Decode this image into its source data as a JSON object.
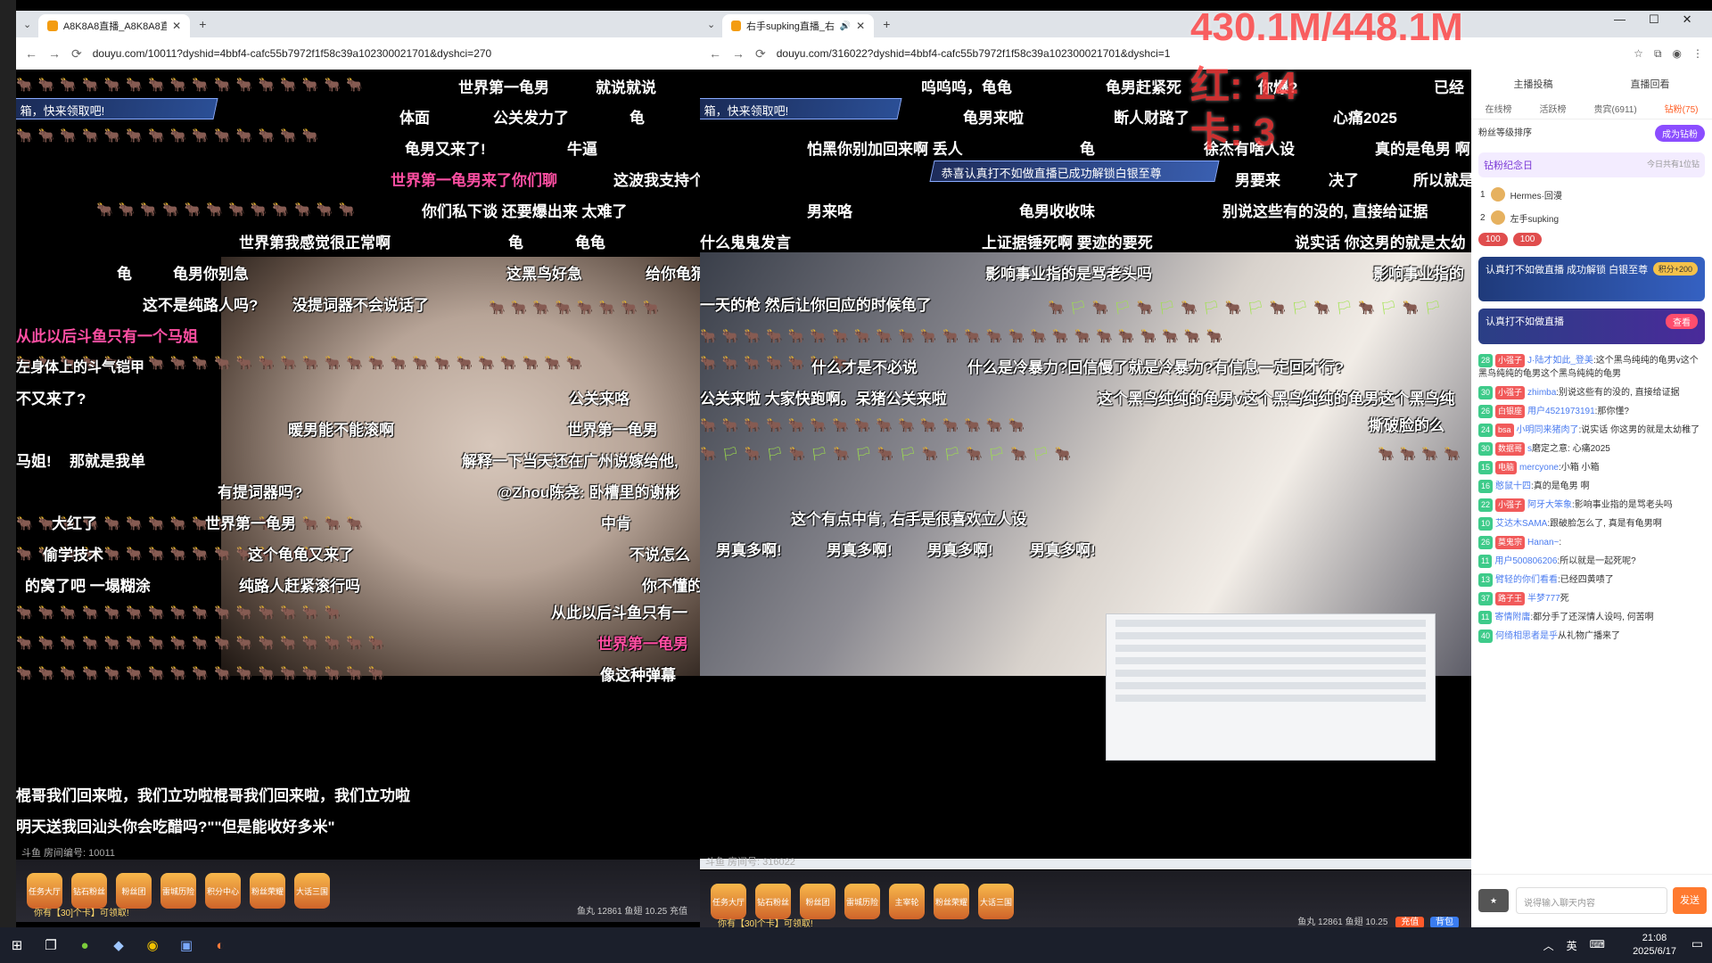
{
  "left_window": {
    "tab_title": "A8K8A8直播_A8K8A8直播_A8...",
    "url": "douyu.com/10011?dyshid=4bbf4-cafc55b7972f1f58c39a102300021701&dyshci=270",
    "room_no": "斗鱼 房间编号: 10011",
    "banner": "箱，快来领取吧!",
    "gift_tip": "你有【30]个卡】可领取!",
    "gift_meta": "鱼丸 12861   鱼翅 10.25   充值",
    "gifts": [
      "任务大厅",
      "钻石粉丝",
      "粉丝团",
      "雷城历险",
      "积分中心",
      "粉丝荣耀",
      "大话三国"
    ],
    "danmaku": [
      "世界第一龟男",
      "就说就说",
      "体面",
      "公关发力了",
      "龟",
      "龟男又来了!",
      "牛逼",
      "世界第一龟男来了你们聊",
      "这波我支持个多月了",
      "你们私下谈 还要爆出来 太难了",
      "世界第我感觉很正常啊",
      "龟",
      "龟龟",
      "龟",
      "龟男你别急",
      "这黑鸟好急",
      "给你龟猜",
      "这不是纯路人吗?",
      "没提词器不会说话了",
      "从此以后斗鱼只有一个马姐",
      "左身体上的斗气铠甲",
      "公关来咯",
      "暖男能不能滚啊",
      "世界第一龟男",
      "解释一下当天还在广州说嫁给他,",
      "有提词器吗?",
      "@Zhou陈尧: 卧槽里的谢彬",
      "世界第一龟男",
      "中肯",
      "这个龟龟又来了",
      "不说怎么",
      "纯路人赶紧滚行吗",
      "你不懂的",
      "从此以后斗鱼只有一",
      "世界第一龟男",
      "像这种弹幕",
      "棍哥我们回来啦，我们立功啦棍哥我们回来啦，我们立功啦",
      "明天送我回汕头你会吃醋吗?\"\"但是能收好多米\"",
      "马姐!",
      "那就是我单",
      "大红了",
      "偷学技术",
      "的窝了吧 一塌糊涂",
      "不又来了?"
    ]
  },
  "right_window": {
    "tab_title": "右手supking直播_右手sup...",
    "url": "douyu.com/316022?dyshid=4bbf4-cafc55b7972f1f58c39a102300021701&dyshci=1",
    "room_no": "斗鱼 房间号: 316022",
    "banner": "箱，快来领取吧!",
    "gift_tip": "你有【30]个卡】可领取!",
    "gift_meta": "鱼丸 12861   鱼翅 10.25",
    "gift_buttons": [
      "充值",
      "背包"
    ],
    "unlock_banner": "恭喜认真打不如做直播已成功解锁白银至尊",
    "gifts": [
      "任务大厅",
      "钻石粉丝",
      "粉丝团",
      "雷城历险",
      "主宰轮",
      "粉丝荣耀",
      "大话三国"
    ],
    "danmaku": [
      "呜呜呜，龟龟",
      "龟男赶紧死",
      "你爆?",
      "已经",
      "龟男来啦",
      "断人财路了",
      "心痛2025",
      "怕黑你别加回来啊 丢人",
      "龟",
      "徐杰有啥人设",
      "真的是龟男 啊",
      "男要来",
      "决了",
      "所以就是",
      "男来咯",
      "龟男收收味",
      "别说这些有的没的, 直接给证据",
      "什么鬼鬼发言",
      "上证据锤死啊 要迹的要死",
      "说实话 你这男的就是太幼",
      "影响事业指的是骂老头吗",
      "影响事业指的",
      "一天的枪 然后让你回应的时候龟了",
      "什么是冷暴力?回信慢了就是冷暴力?有信息一定回才行?",
      "公关来啦 大家快跑啊。呆猪公关来啦",
      "这个黑鸟纯纯的龟男v这个黑鸟纯纯的龟男这个黑鸟纯",
      "撕破脸的么",
      "这个有点中肯, 右手是很喜欢立人设",
      "男真多啊!",
      "男真多啊!",
      "男真多啊!",
      "男真多啊!",
      "什么才是不必说"
    ]
  },
  "sidebar": {
    "top_buttons": [
      "主播投稿",
      "直播回看"
    ],
    "tabs": [
      "在线榜",
      "活跃榜",
      "贵宾(6911)",
      "钻粉(75)"
    ],
    "fan_group": "粉丝等级排序",
    "fan_cta": "成为钻粉",
    "rank_title": "钻粉纪念日",
    "rank_sub": "今日共有1位钻",
    "rank_rows": [
      {
        "no": "1",
        "name": "Hermes·回漫"
      },
      {
        "no": "2",
        "name": "左手supking"
      }
    ],
    "promo": "认真打不如做直播 成功解锁 白银至尊",
    "promo_side": "积分+200",
    "promo2": "认真打不如做直播",
    "promo2_btn": "查看",
    "chat": [
      {
        "lv": "28",
        "badge": "小强子",
        "user": "J·陆才如此_登美",
        "text": ":这个黑鸟纯纯的龟男v这个黑鸟纯纯的龟男这个黑鸟纯纯的龟男"
      },
      {
        "lv": "30",
        "badge": "小强子",
        "user": "zhimba",
        "text": ":别说这些有的没的, 直接给证据"
      },
      {
        "lv": "26",
        "badge": "白银座",
        "user": "用户4521973191",
        "text": ":那你懂?"
      },
      {
        "lv": "24",
        "badge": "bsa",
        "user": "小明同来猪肉了",
        "text": ":说实话 你这男的就是太幼稚了"
      },
      {
        "lv": "30",
        "badge": "数据哥",
        "user": "s",
        "text": "磨定之意: 心痛2025"
      },
      {
        "lv": "15",
        "badge": "电脑",
        "user": "mercyone",
        "text": ":小箱 小箱"
      },
      {
        "lv": "16",
        "badge": "",
        "user": "憨鼠十四",
        "text": ":真的是龟男 啊"
      },
      {
        "lv": "22",
        "badge": "小强子",
        "user": "阿牙大笨象",
        "text": ":影响事业指的是骂老头吗"
      },
      {
        "lv": "10",
        "badge": "",
        "user": "艾达木SAMA",
        "text": ":跟破脸怎么了, 真是有龟男啊"
      },
      {
        "lv": "26",
        "badge": "莫鬼宗",
        "user": "Hanan~",
        "text": ":"
      },
      {
        "lv": "11",
        "badge": "",
        "user": "用户500806206",
        "text": ":所以就是一起死呢?"
      },
      {
        "lv": "13",
        "badge": "",
        "user": "臂轻的你们看看",
        "text": ":已经四黄啧了"
      },
      {
        "lv": "37",
        "badge": "路子王",
        "user": "半梦777",
        "text": "死"
      },
      {
        "lv": "11",
        "badge": "",
        "user": "寄情附庸",
        "text": ":都分手了还深情人设吗, 何苦啊"
      },
      {
        "lv": "40",
        "badge": "",
        "user": "何绮相思者是乎",
        "text": "从礼物广播来了"
      }
    ],
    "chat_input_placeholder": "说得输入聊天内容",
    "send": "发送"
  },
  "overlay": {
    "memory": "430.1M/448.1M",
    "red": "红: 14",
    "card": "卡: 3"
  },
  "taskbar": {
    "time": "21:08",
    "date": "2025/6/17",
    "lang": "英",
    "tray_icon": "ime-icon"
  }
}
